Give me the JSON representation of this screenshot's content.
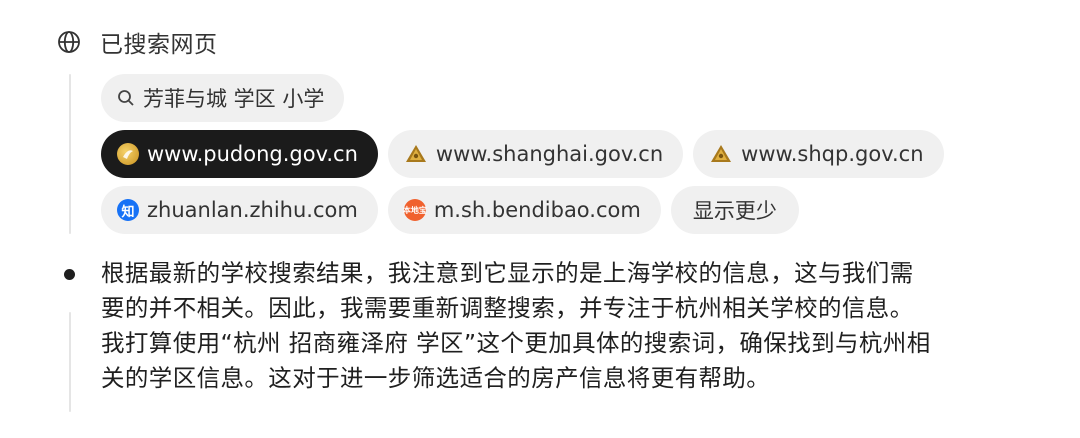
{
  "header": {
    "title": "已搜索网页",
    "icon": "globe-icon"
  },
  "search_query": {
    "icon": "search-icon",
    "text": "芳菲与城 学区 小学"
  },
  "sources": [
    {
      "label": "www.pudong.gov.cn",
      "icon": "pudong-favicon",
      "selected": true
    },
    {
      "label": "www.shanghai.gov.cn",
      "icon": "shanghai-gov-favicon",
      "selected": false
    },
    {
      "label": "www.shqp.gov.cn",
      "icon": "shanghai-gov-favicon",
      "selected": false
    },
    {
      "label": "zhuanlan.zhihu.com",
      "icon": "zhihu-favicon",
      "favicon_text": "知",
      "selected": false
    },
    {
      "label": "m.sh.bendibao.com",
      "icon": "bendibao-favicon",
      "favicon_text": "本地宝",
      "selected": false
    }
  ],
  "show_less_label": "显示更少",
  "message": {
    "text": "根据最新的学校搜索结果，我注意到它显示的是上海学校的信息，这与我们需\n要的并不相关。因此，我需要重新调整搜索，并专注于杭州相关学校的信息。\n我打算使用“杭州 招商雍泽府 学区”这个更加具体的搜索词，确保找到与杭州相\n关的学区信息。这对于进一步筛选适合的房产信息将更有帮助。"
  },
  "colors": {
    "chip_bg": "#f0f0f0",
    "chip_selected_bg": "#1b1b1b",
    "zhihu_blue": "#1772f6",
    "bendibao_orange": "#f0612e"
  }
}
